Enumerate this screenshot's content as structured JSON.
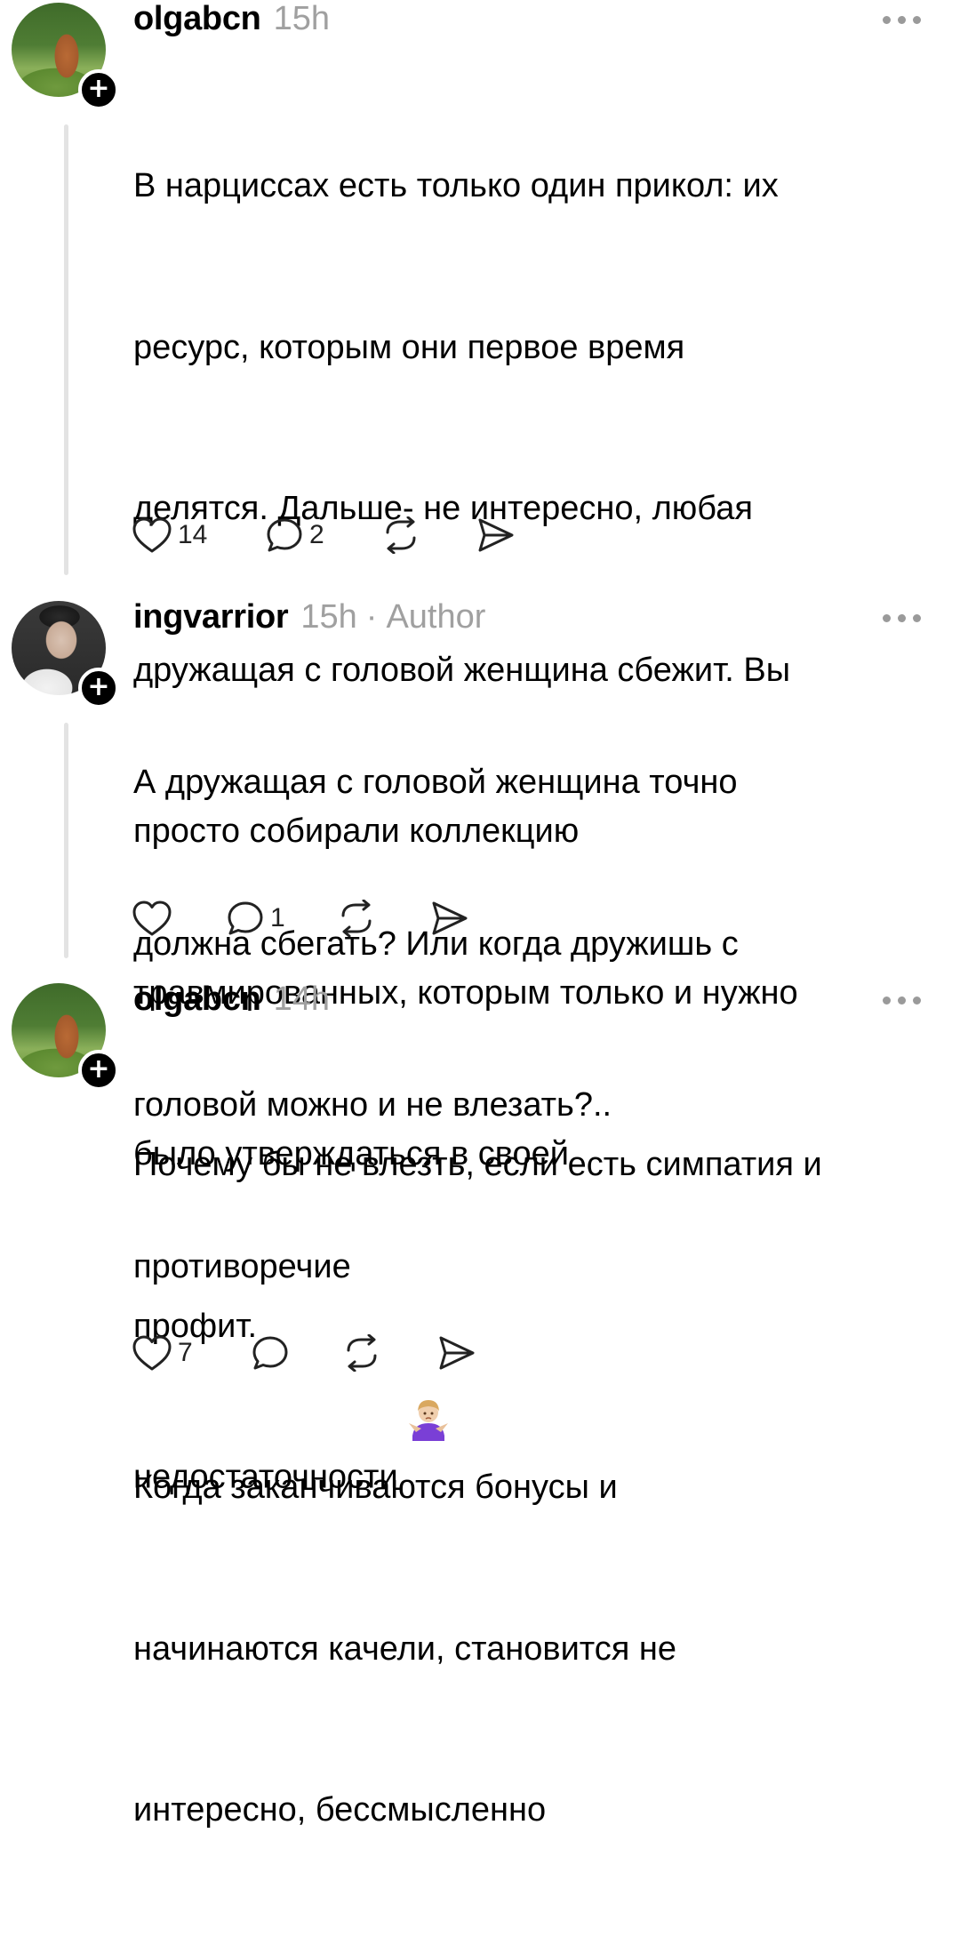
{
  "comments": [
    {
      "username": "olgabcn",
      "time": "15h",
      "author_tag": "",
      "text_lines": [
        "В нарциссах есть только один прикол: их",
        "ресурс, которым они первое время",
        "делятся. Дальше- не интересно, любая",
        "дружащая с головой женщина сбежит. Вы",
        "просто собирали коллекцию",
        "травмированных, которым только и нужно",
        "было утверждаться в своей",
        "недостаточности"
      ],
      "emoji": "person-shrugging",
      "likes": "14",
      "replies": "2"
    },
    {
      "username": "ingvarrior",
      "time": "15h",
      "author_tag": "Author",
      "text_lines": [
        "А дружащая с головой женщина точно",
        "должна сбегать? Или когда дружишь с",
        "головой можно и не влезать?..",
        "противоречие"
      ],
      "likes": "",
      "replies": "1"
    },
    {
      "username": "olgabcn",
      "time": "14h",
      "author_tag": "",
      "text_lines": [
        "Почему бы не влезть, если есть симпатия и",
        "профит.",
        "Когда заканчиваются бонусы и",
        "начинаются качели, становится не",
        "интересно, бессмысленно"
      ],
      "likes": "7",
      "replies": ""
    }
  ],
  "icons": {
    "follow": "plus-icon",
    "more": "more-dots-icon",
    "like": "heart-icon",
    "reply": "comment-bubble-icon",
    "repost": "repost-icon",
    "share": "send-icon"
  },
  "colors": {
    "text": "#000000",
    "meta": "#a0a0a0",
    "thread_line": "#e3e3e3",
    "icon": "#222222"
  }
}
